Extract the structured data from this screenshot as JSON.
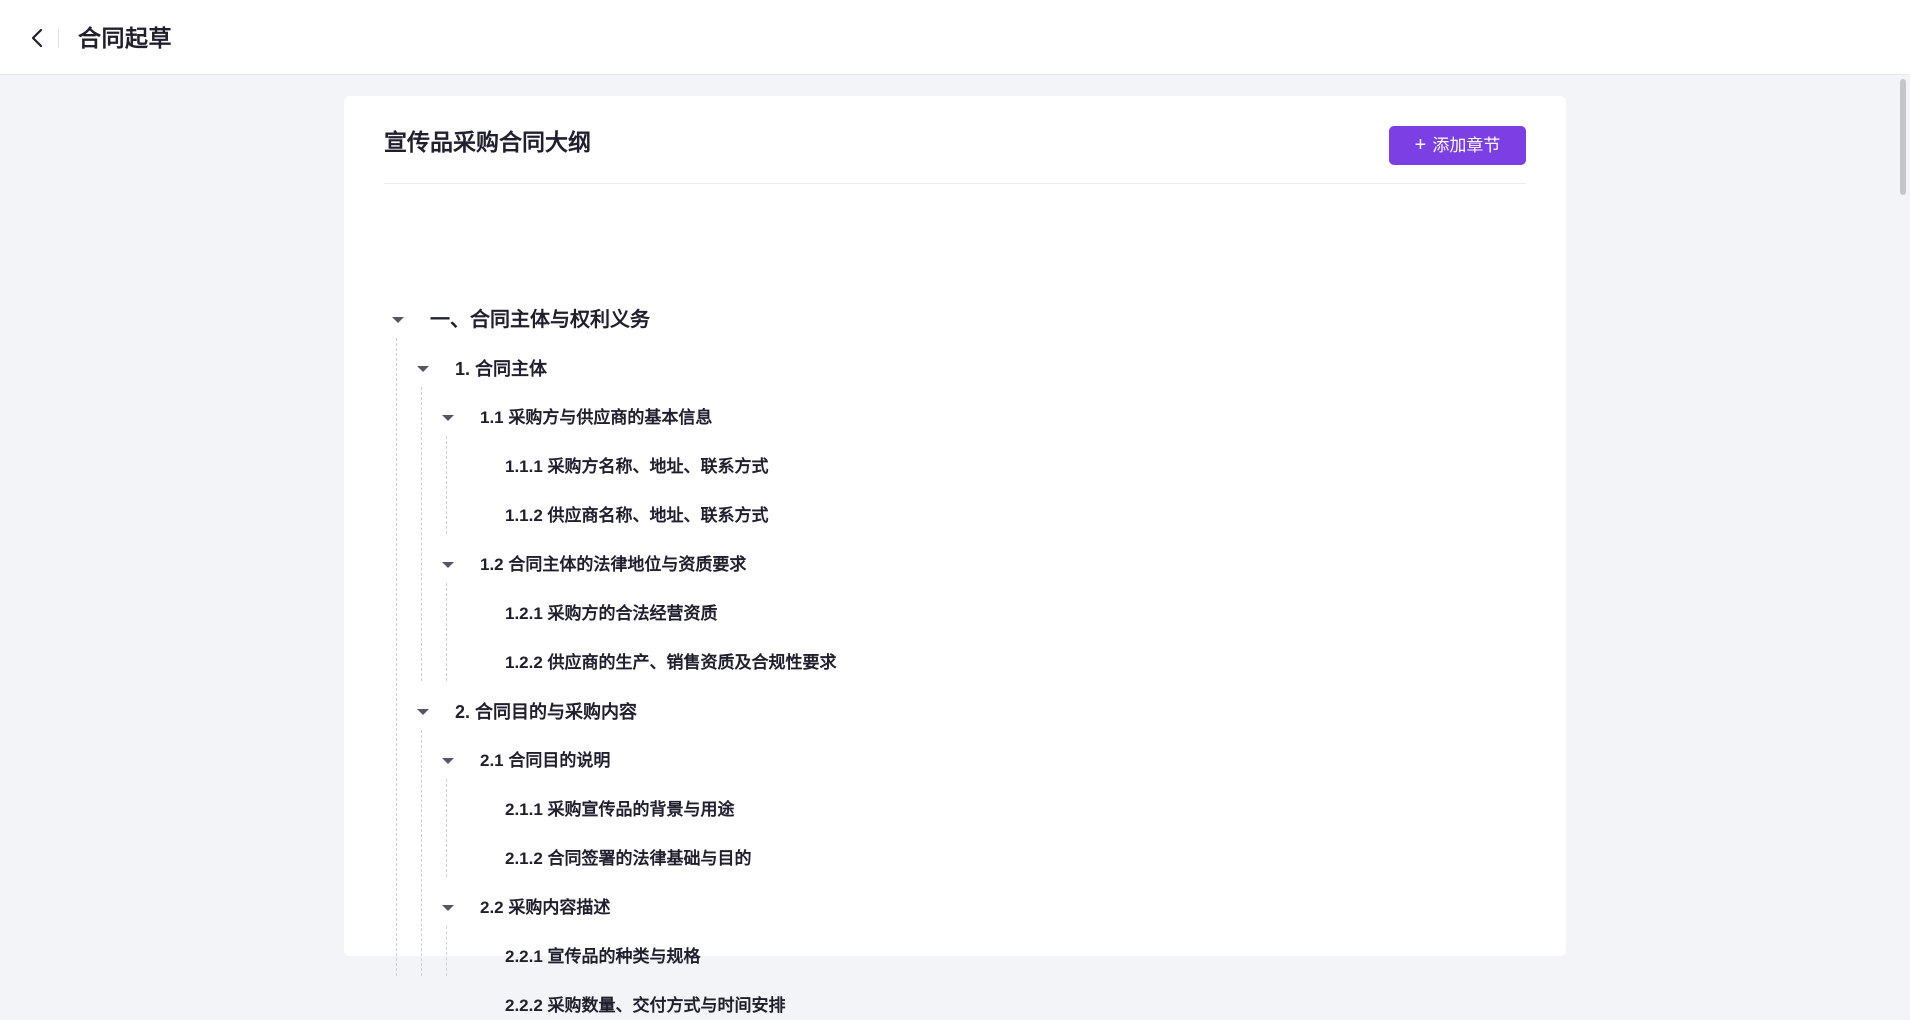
{
  "header": {
    "title": "合同起草"
  },
  "outline": {
    "title": "宣传品采购合同大纲",
    "add_button_label": "添加章节",
    "add_button_icon": "plus-icon",
    "accent_color": "#7b3fe4"
  },
  "tree": [
    {
      "label": "一、合同主体与权利义务",
      "level": 0,
      "expanded": true
    },
    {
      "label": "1. 合同主体",
      "level": 1,
      "expanded": true
    },
    {
      "label": "1.1 采购方与供应商的基本信息",
      "level": 2,
      "expanded": true
    },
    {
      "label": "1.1.1 采购方名称、地址、联系方式",
      "level": 3
    },
    {
      "label": "1.1.2 供应商名称、地址、联系方式",
      "level": 3
    },
    {
      "label": "1.2 合同主体的法律地位与资质要求",
      "level": 2,
      "expanded": true
    },
    {
      "label": "1.2.1 采购方的合法经营资质",
      "level": 3
    },
    {
      "label": "1.2.2 供应商的生产、销售资质及合规性要求",
      "level": 3
    },
    {
      "label": "2. 合同目的与采购内容",
      "level": 1,
      "expanded": true
    },
    {
      "label": "2.1 合同目的说明",
      "level": 2,
      "expanded": true
    },
    {
      "label": "2.1.1 采购宣传品的背景与用途",
      "level": 3
    },
    {
      "label": "2.1.2 合同签署的法律基础与目的",
      "level": 3
    },
    {
      "label": "2.2 采购内容描述",
      "level": 2,
      "expanded": true
    },
    {
      "label": "2.2.1 宣传品的种类与规格",
      "level": 3
    },
    {
      "label": "2.2.2 采购数量、交付方式与时间安排",
      "level": 3
    }
  ]
}
